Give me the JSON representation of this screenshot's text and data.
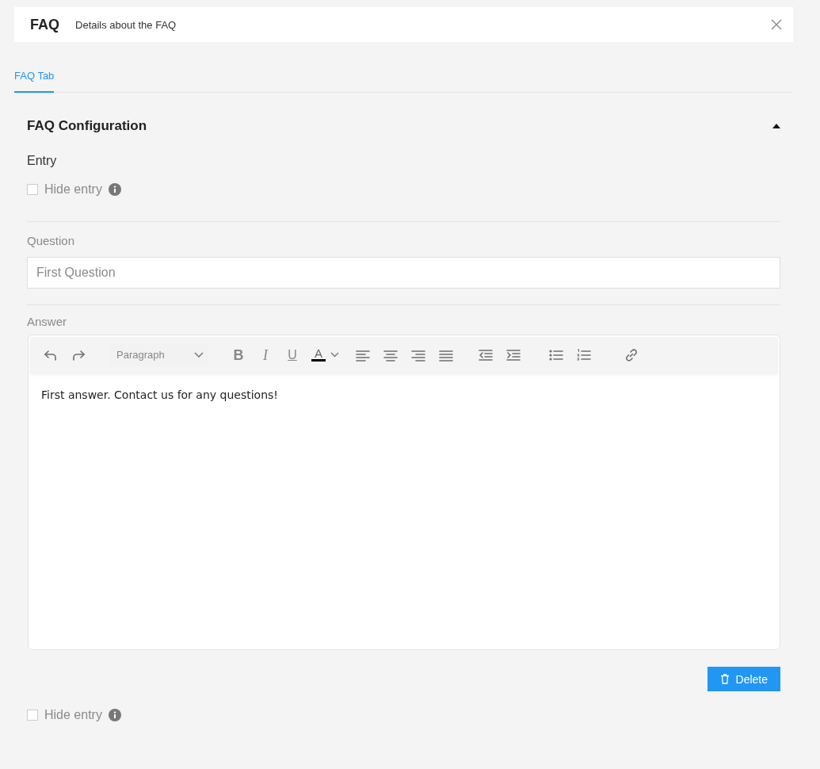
{
  "header": {
    "title": "FAQ",
    "subtitle": "Details about the FAQ"
  },
  "tabs": [
    {
      "label": "FAQ Tab",
      "selected": true
    }
  ],
  "section": {
    "title": "FAQ Configuration",
    "expanded": true,
    "entry_label": "Entry",
    "hide_entry": {
      "label": "Hide entry",
      "checked": false
    },
    "question": {
      "label": "Question",
      "value": "First Question"
    },
    "answer": {
      "label": "Answer",
      "format": "Paragraph",
      "bold": "B",
      "italic": "I",
      "underline": "U",
      "text_color_glyph": "A",
      "color": "#000000",
      "text": "First answer. Contact us for any questions!"
    },
    "delete_button": "Delete"
  },
  "next_entry": {
    "hide_entry": {
      "label": "Hide entry",
      "checked": false
    }
  }
}
